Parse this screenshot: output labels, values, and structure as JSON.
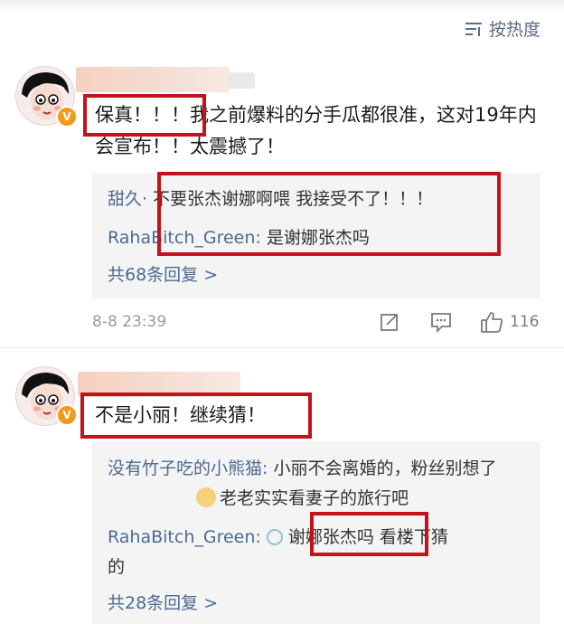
{
  "sort": {
    "label": "按热度"
  },
  "comments": [
    {
      "text": "保真！！！我之前爆料的分手瓜都很准，这对19年内会宣布！！太震撼了！",
      "replies": [
        {
          "user": "甜久·",
          "text": "不要张杰谢娜啊喂 我接受不了！！！"
        },
        {
          "user": "RahaBitch_Green:",
          "text": " 是谢娜张杰吗"
        }
      ],
      "more_label": "共68条回复 >",
      "time": "8-8 23:39",
      "like_count": "116"
    },
    {
      "text": "不是小丽！继续猜！",
      "replies": [
        {
          "user": "没有竹子吃的小熊猫:",
          "text": " 小丽不会离婚的，粉丝别想了",
          "text_cont": "老老实实看妻子的旅行吧"
        },
        {
          "user": "RahaBitch_Green:",
          "text": "谢娜张杰吗 看楼下猜",
          "text_cont": "的"
        }
      ],
      "more_label": "共28条回复 >"
    }
  ],
  "colors": {
    "highlight": "#c4121b",
    "link": "#4d6a91",
    "badge": "#f19a1c"
  },
  "icons": [
    "sort-icon",
    "share-icon",
    "comment-icon",
    "like-icon",
    "v-badge-icon",
    "emoji-icon"
  ]
}
